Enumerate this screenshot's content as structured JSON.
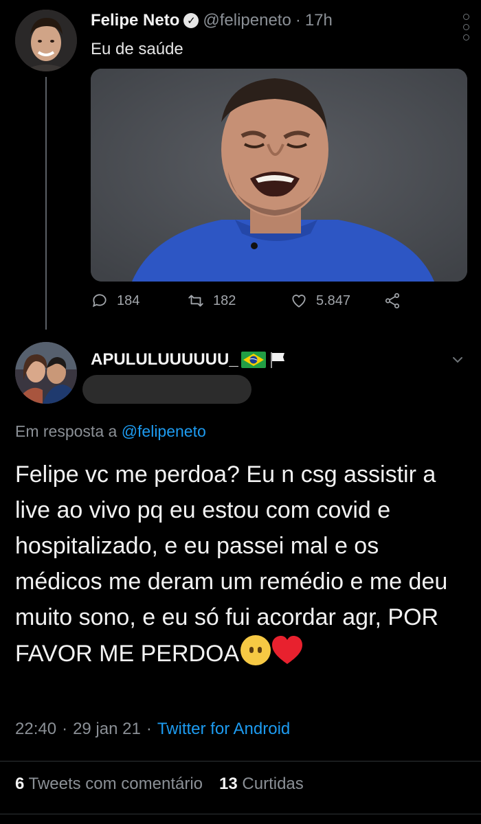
{
  "tweet": {
    "author_name": "Felipe Neto",
    "handle": "@felipeneto",
    "separator": "·",
    "time": "17h",
    "text": "Eu de saúde",
    "counts": {
      "replies": "184",
      "retweets": "182",
      "likes": "5.847"
    }
  },
  "reply": {
    "author_name": "APULULUUUUUU_",
    "reply_prefix": "Em resposta a",
    "reply_to": "@felipeneto",
    "text": "Felipe vc me perdoa? Eu n csg assistir a live ao vivo pq eu estou com covid e hospitalizado, e eu passei mal e os médicos me deram um remédio e me deu muito sono, e eu só fui acordar agr, POR FAVOR ME PERDOA",
    "time": "22:40",
    "date": "29 jan 21",
    "dot": "·",
    "source": "Twitter for Android",
    "stats": {
      "quotes_count": "6",
      "quotes_label": "Tweets com comentário",
      "likes_count": "13",
      "likes_label": "Curtidas"
    }
  },
  "icons": {
    "verified": "verified-badge-icon",
    "more": "more-vertical-icon",
    "reply": "reply-icon",
    "retweet": "retweet-icon",
    "like": "heart-icon",
    "share": "share-icon",
    "chevron": "chevron-down-icon",
    "brazil_flag": "brazil-flag-icon",
    "white_flag": "white-flag-icon"
  },
  "colors": {
    "background": "#000000",
    "link": "#1d9bf0",
    "muted": "#8b9096",
    "text": "#f2f2f2"
  }
}
